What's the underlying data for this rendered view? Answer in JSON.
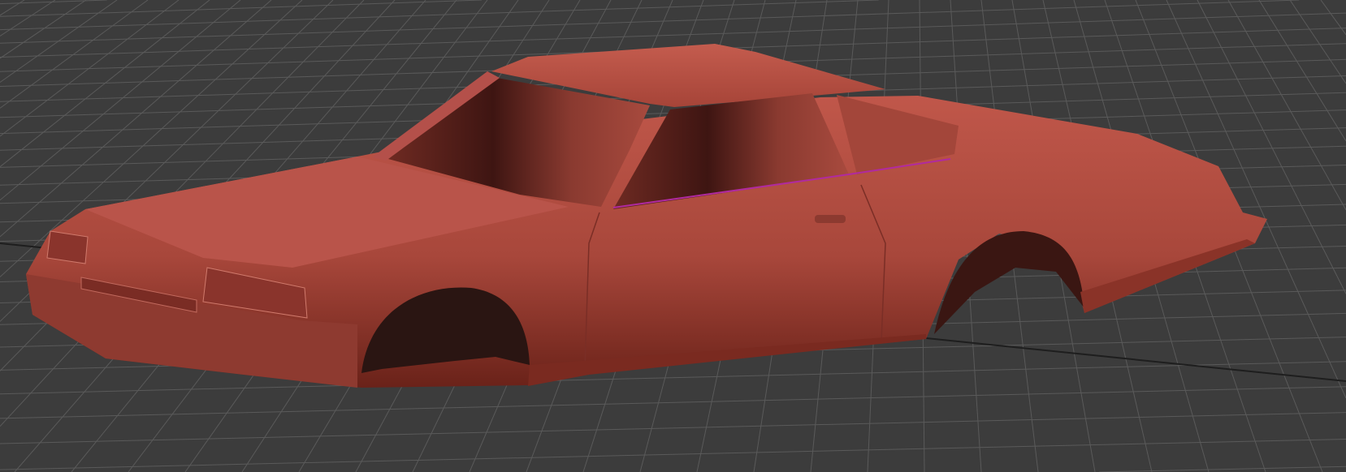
{
  "viewport": {
    "background_color": "#3c3c3c",
    "grid_color": "#5a5a5a",
    "grid_axis_color": "#1e1e1e",
    "model": {
      "name_icon": "car-body-model",
      "body_color": "#b24c40",
      "shadow_color": "#5c1a14",
      "selection_edge_color": "#b02aa0"
    }
  }
}
